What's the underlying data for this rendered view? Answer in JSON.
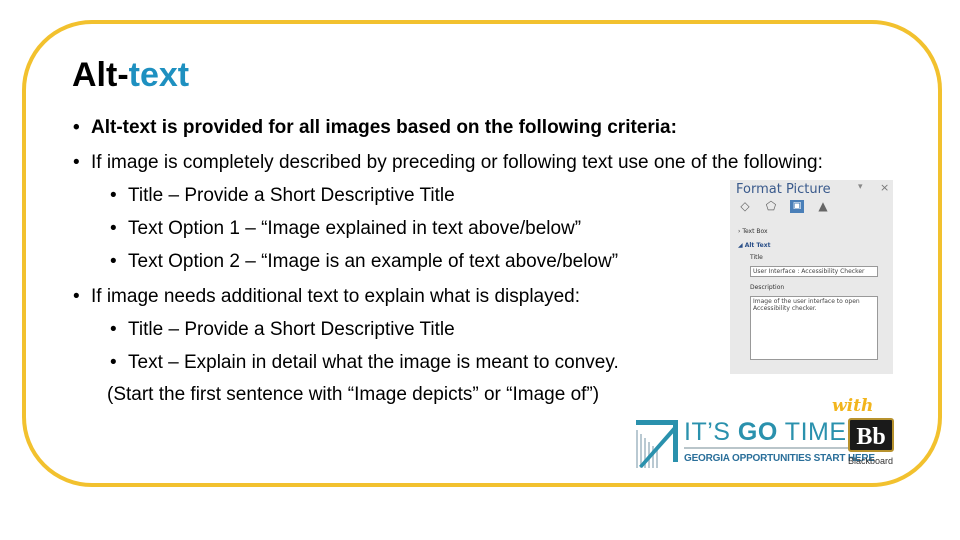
{
  "slide": {
    "title_plain": "Alt-",
    "title_accent": "text",
    "accent_color": "#1e90c0",
    "border_color": "#f2c12e",
    "bullets": [
      {
        "level": 1,
        "bold": true,
        "text": "Alt-text is provided for all images based on the following criteria:"
      },
      {
        "level": 1,
        "bold": false,
        "text": "If image is completely described by preceding or following text use one of the following:"
      },
      {
        "level": 2,
        "bold": false,
        "text": "Title – Provide a Short Descriptive Title"
      },
      {
        "level": 2,
        "bold": false,
        "text": "Text Option 1 – “Image explained in text above/below”"
      },
      {
        "level": 2,
        "bold": false,
        "text": "Text Option 2 – “Image is an example of text above/below”"
      },
      {
        "level": 1,
        "bold": false,
        "text": "If image needs additional text to explain what is displayed:"
      },
      {
        "level": 2,
        "bold": false,
        "text": "Title – Provide a Short Descriptive Title"
      },
      {
        "level": 2,
        "bold": false,
        "text": "Text – Explain in detail what the image is meant to convey."
      }
    ],
    "note": "(Start the first sentence with “Image depicts” or “Image of”)",
    "bullet_glyph": "•"
  },
  "format_picture_panel": {
    "title": "Format Picture",
    "pin_glyph": "▾",
    "close_glyph": "×",
    "icons": [
      "fill-line-icon",
      "effects-icon",
      "size-properties-icon",
      "picture-icon"
    ],
    "sections": {
      "text_box": "Text Box",
      "alt_text": "Alt Text",
      "title_label": "Title",
      "title_value": "User Interface : Accessibility Checker",
      "description_label": "Description",
      "description_value": "Image of the user interface to open Accessibility checker."
    }
  },
  "logo": {
    "headline_a": "IT’S ",
    "headline_b": "GO",
    "headline_c": " TIME",
    "subline": "GEORGIA OPPORTUNITIES START HERE",
    "with": "with",
    "bb": "Bb",
    "bb_label": "Blackboard"
  }
}
